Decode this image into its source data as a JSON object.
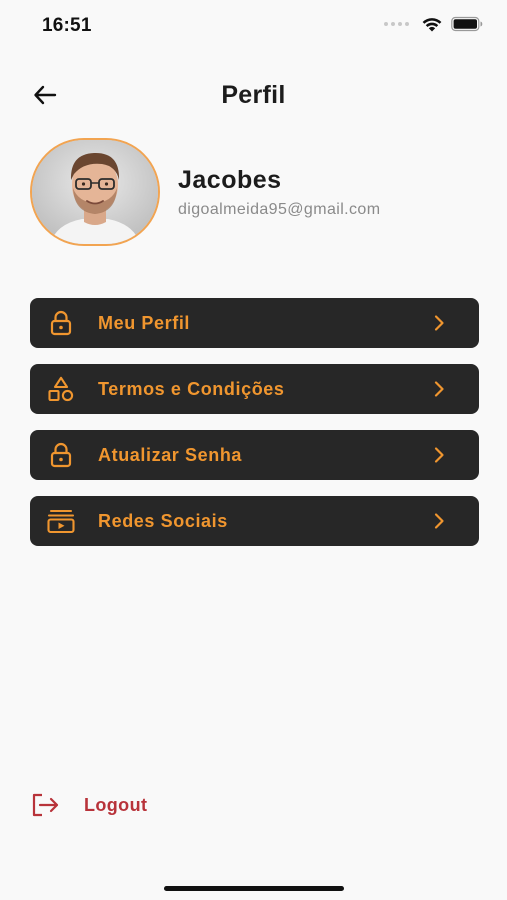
{
  "status_bar": {
    "time": "16:51",
    "icons": [
      "signal-dots-icon",
      "wifi-icon",
      "battery-icon"
    ]
  },
  "header": {
    "title": "Perfil",
    "back_icon": "arrow-left-icon"
  },
  "profile": {
    "name": "Jacobes",
    "email": "digoalmeida95@gmail.com",
    "avatar_border_color": "#f2a451"
  },
  "menu": {
    "items": [
      {
        "label": "Meu Perfil",
        "icon": "lock-icon"
      },
      {
        "label": "Termos e Condições",
        "icon": "shapes-icon"
      },
      {
        "label": "Atualizar Senha",
        "icon": "lock-icon"
      },
      {
        "label": "Redes Sociais",
        "icon": "video-library-icon"
      }
    ],
    "chevron_icon": "chevron-right-icon"
  },
  "logout": {
    "label": "Logout",
    "icon": "logout-icon"
  },
  "colors": {
    "background": "#f9f9f9",
    "menu_background": "#272727",
    "accent": "#f0962f",
    "logout": "#b8333a",
    "text_primary": "#1c1c1c",
    "text_secondary": "#8a8a8a"
  }
}
